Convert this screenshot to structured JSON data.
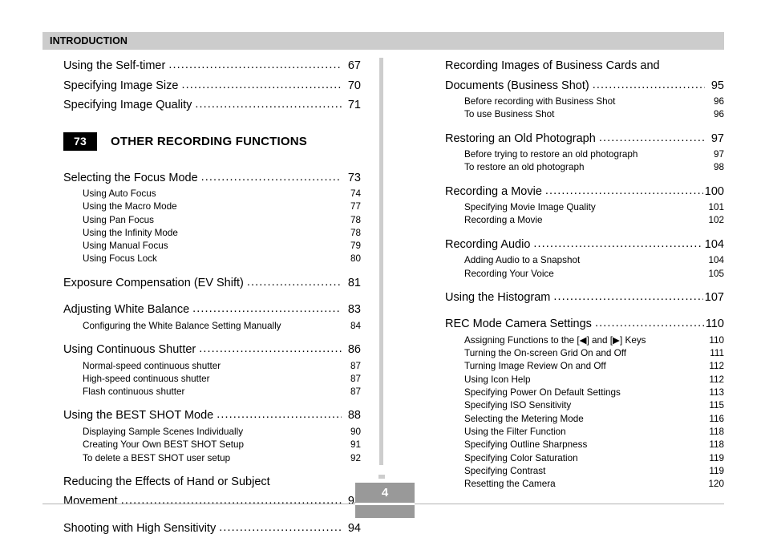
{
  "header": {
    "title": "INTRODUCTION"
  },
  "colors": {
    "header_bar": "#cccccc",
    "divider": "#cdcdcd",
    "chapter_badge": "#000000",
    "page_box": "#999999",
    "footer_rule": "#b3b3b3"
  },
  "left_column": {
    "top_entries": [
      {
        "label": "Using the Self-timer",
        "page": "67"
      },
      {
        "label": "Specifying Image Size",
        "page": "70"
      },
      {
        "label": "Specifying Image Quality",
        "page": "71"
      }
    ],
    "chapter": {
      "number": "73",
      "title": "OTHER RECORDING FUNCTIONS"
    },
    "sections": [
      {
        "label": "Selecting the Focus Mode",
        "page": "73",
        "subs": [
          {
            "label": "Using Auto Focus",
            "page": "74"
          },
          {
            "label": "Using the Macro Mode",
            "page": "77"
          },
          {
            "label": "Using Pan Focus",
            "page": "78"
          },
          {
            "label": "Using the Infinity Mode",
            "page": "78"
          },
          {
            "label": "Using Manual Focus",
            "page": "79"
          },
          {
            "label": "Using Focus Lock",
            "page": "80"
          }
        ]
      },
      {
        "label": "Exposure Compensation (EV Shift)",
        "page": "81",
        "subs": []
      },
      {
        "label": "Adjusting White Balance",
        "page": "83",
        "subs": [
          {
            "label": "Configuring the White Balance Setting Manually",
            "page": "84"
          }
        ]
      },
      {
        "label": "Using Continuous Shutter",
        "page": "86",
        "subs": [
          {
            "label": "Normal-speed continuous shutter",
            "page": "87"
          },
          {
            "label": "High-speed continuous shutter",
            "page": "87"
          },
          {
            "label": "Flash continuous shutter",
            "page": "87"
          }
        ]
      },
      {
        "label": "Using the BEST SHOT Mode",
        "page": "88",
        "subs": [
          {
            "label": "Displaying Sample Scenes Individually",
            "page": "90"
          },
          {
            "label": "Creating Your Own BEST SHOT Setup",
            "page": "91"
          },
          {
            "label": "To delete a BEST SHOT user setup",
            "page": "92"
          }
        ]
      },
      {
        "label_line1": "Reducing the Effects of Hand or Subject",
        "label": "Movement",
        "page": "93",
        "subs": []
      },
      {
        "label": "Shooting with High Sensitivity",
        "page": "94",
        "subs": []
      }
    ]
  },
  "right_column": {
    "sections": [
      {
        "label_line1": "Recording Images of Business Cards and",
        "label": "Documents (Business Shot)",
        "page": "95",
        "subs": [
          {
            "label": "Before recording with Business Shot",
            "page": "96"
          },
          {
            "label": "To use Business Shot",
            "page": "96"
          }
        ]
      },
      {
        "label": "Restoring an Old Photograph",
        "page": "97",
        "subs": [
          {
            "label": "Before trying to restore an old photograph",
            "page": "97"
          },
          {
            "label": "To restore an old photograph",
            "page": "98"
          }
        ]
      },
      {
        "label": "Recording a Movie",
        "page": "100",
        "subs": [
          {
            "label": "Specifying Movie Image Quality",
            "page": "101"
          },
          {
            "label": "Recording a Movie",
            "page": "102"
          }
        ]
      },
      {
        "label": "Recording Audio",
        "page": "104",
        "subs": [
          {
            "label": "Adding Audio to a Snapshot",
            "page": "104"
          },
          {
            "label": "Recording Your Voice",
            "page": "105"
          }
        ]
      },
      {
        "label": "Using the Histogram",
        "page": "107",
        "subs": []
      },
      {
        "label": "REC Mode Camera Settings",
        "page": "110",
        "subs": [
          {
            "label": "Assigning Functions to the [◀] and [▶] Keys",
            "page": "110"
          },
          {
            "label": "Turning the On-screen Grid On and Off",
            "page": "111"
          },
          {
            "label": "Turning Image Review On and Off",
            "page": "112"
          },
          {
            "label": "Using Icon Help",
            "page": "112"
          },
          {
            "label": "Specifying Power On Default Settings",
            "page": "113"
          },
          {
            "label": "Specifying ISO Sensitivity",
            "page": "115"
          },
          {
            "label": "Selecting the Metering Mode",
            "page": "116"
          },
          {
            "label": "Using the Filter Function",
            "page": "118"
          },
          {
            "label": "Specifying Outline Sharpness",
            "page": "118"
          },
          {
            "label": "Specifying Color Saturation",
            "page": "119"
          },
          {
            "label": "Specifying Contrast",
            "page": "119"
          },
          {
            "label": "Resetting the Camera",
            "page": "120"
          }
        ]
      }
    ]
  },
  "footer": {
    "page_number": "4"
  }
}
